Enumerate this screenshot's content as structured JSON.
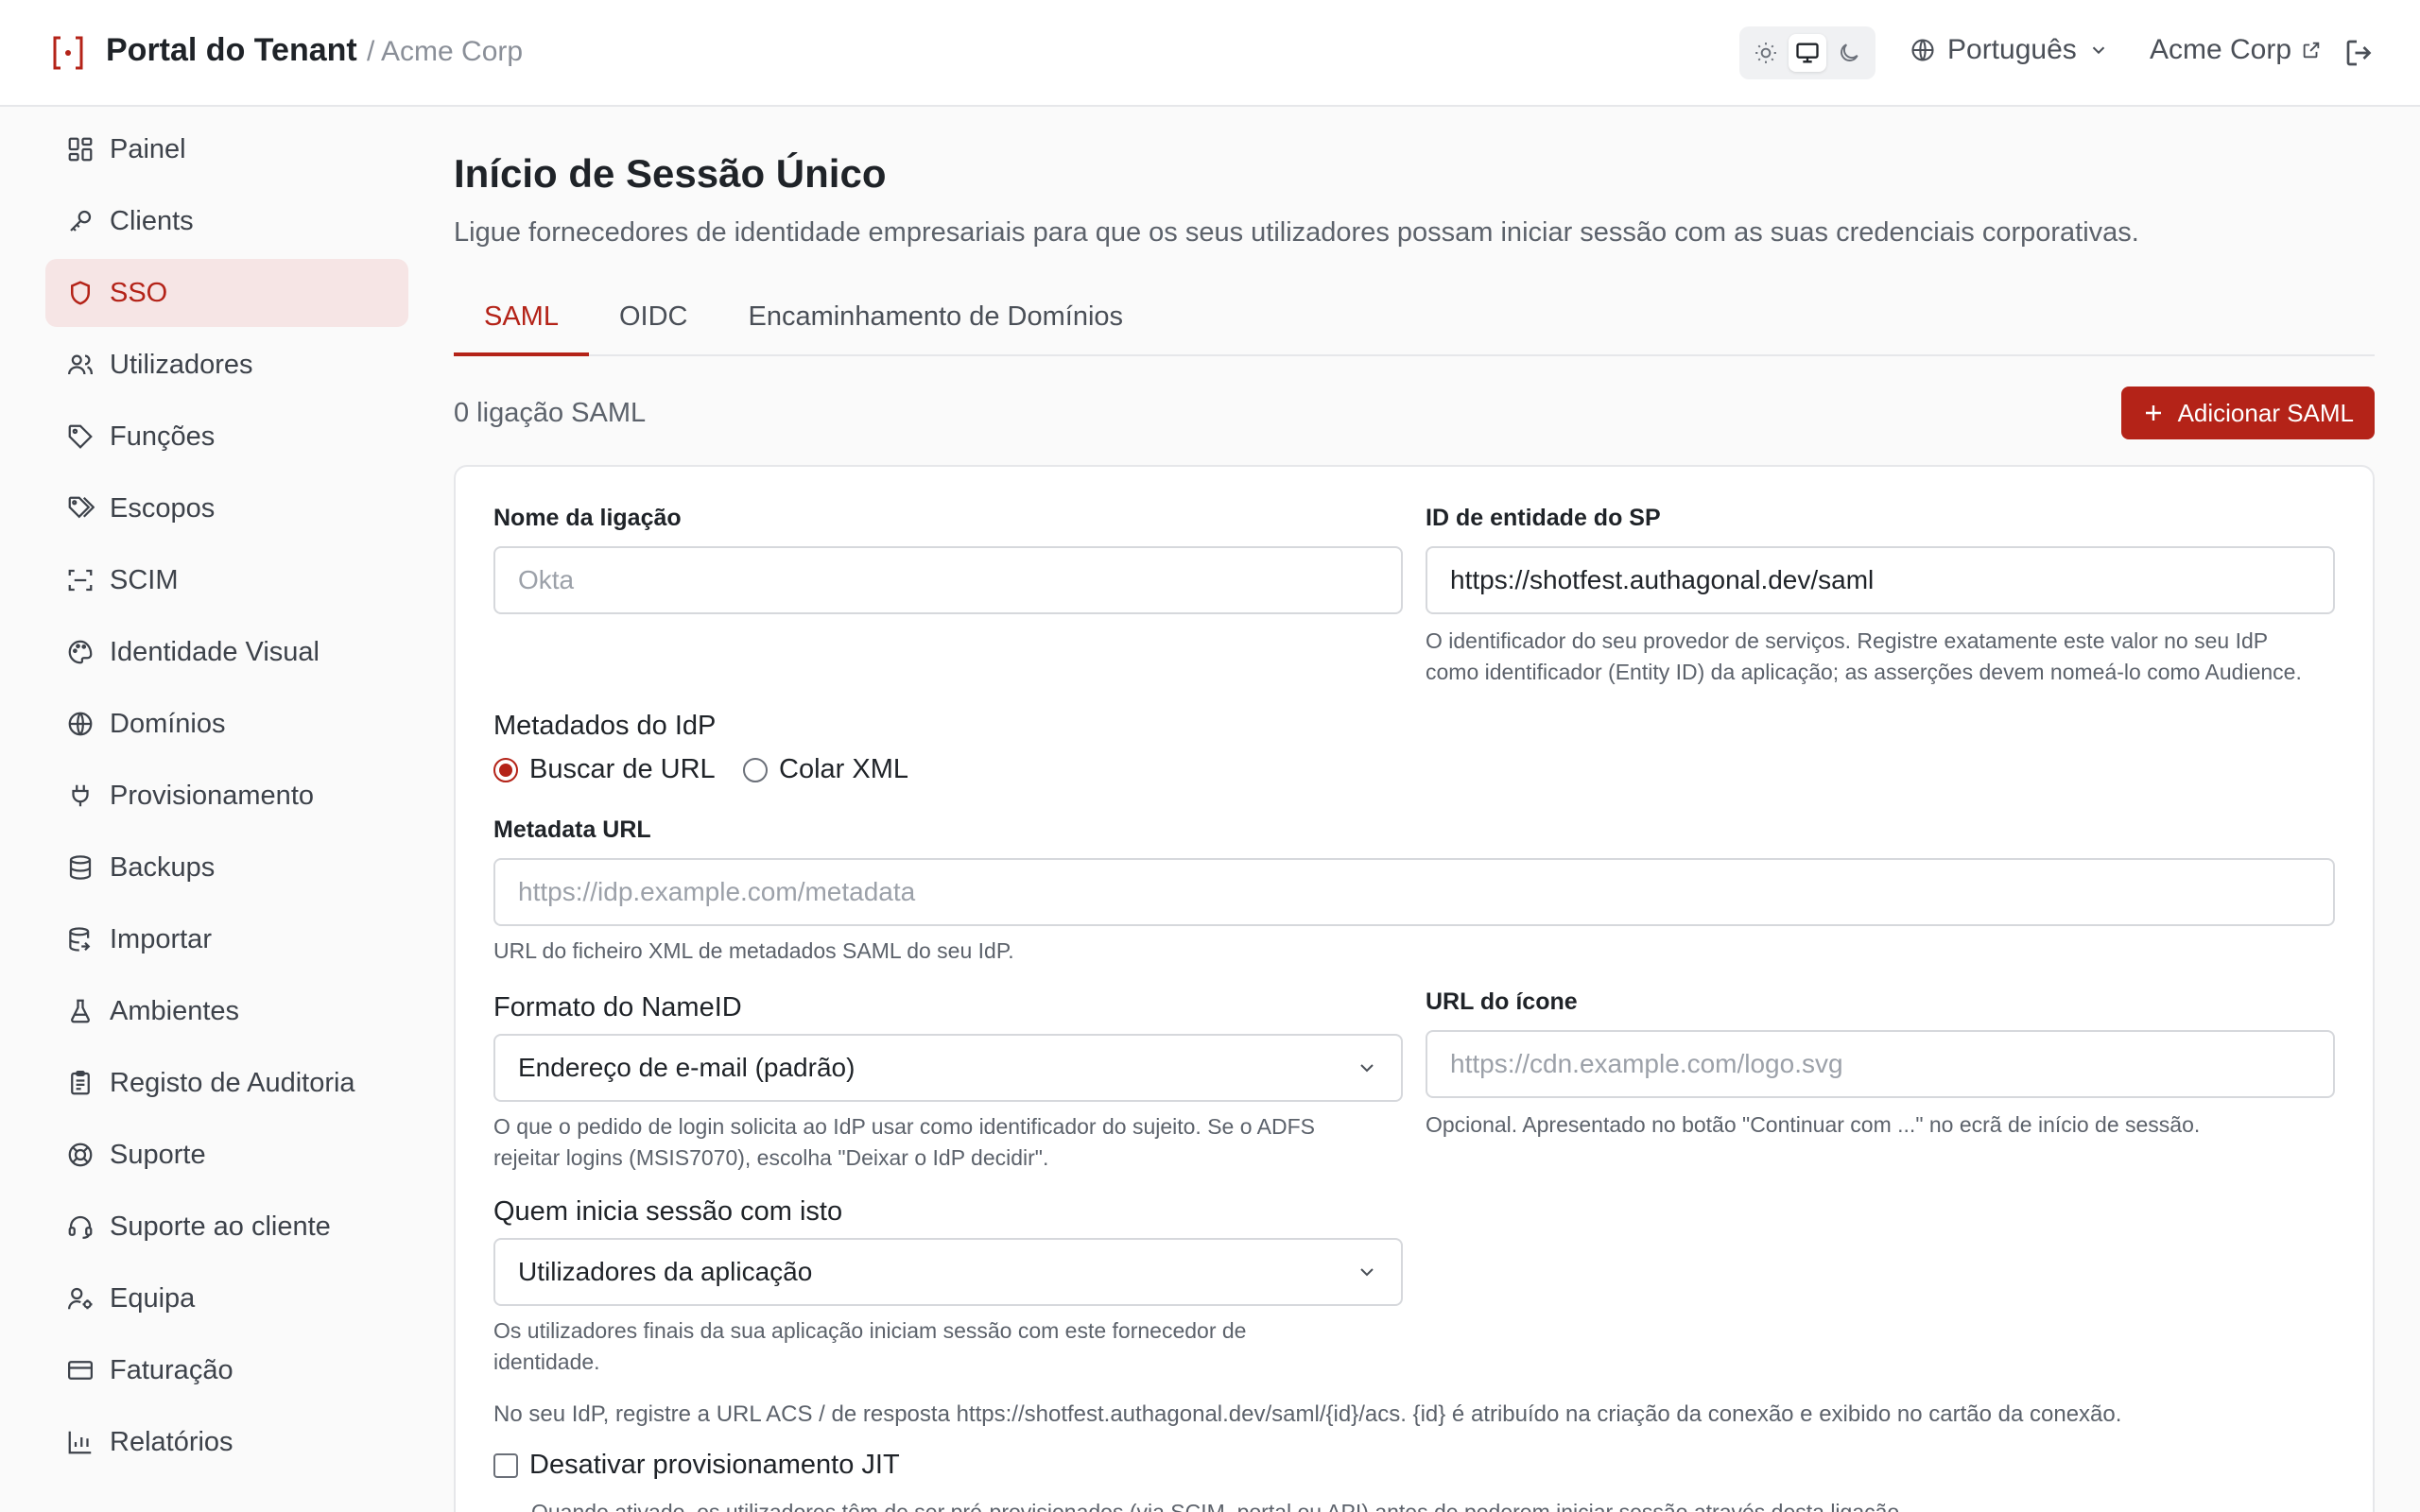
{
  "header": {
    "brand_title": "Portal do Tenant",
    "brand_sub": "/ Acme Corp",
    "language": "Português",
    "tenant_link": "Acme Corp"
  },
  "colors": {
    "accent": "#b42318",
    "active_bg": "#f6e5e5"
  },
  "sidebar": {
    "items": [
      {
        "label": "Painel",
        "icon": "dashboard-icon"
      },
      {
        "label": "Clients",
        "icon": "key-icon"
      },
      {
        "label": "SSO",
        "icon": "shield-icon"
      },
      {
        "label": "Utilizadores",
        "icon": "users-icon"
      },
      {
        "label": "Funções",
        "icon": "tag-icon"
      },
      {
        "label": "Escopos",
        "icon": "tags-icon"
      },
      {
        "label": "SCIM",
        "icon": "scan-icon"
      },
      {
        "label": "Identidade Visual",
        "icon": "palette-icon"
      },
      {
        "label": "Domínios",
        "icon": "globe-icon"
      },
      {
        "label": "Provisionamento",
        "icon": "plug-icon"
      },
      {
        "label": "Backups",
        "icon": "database-icon"
      },
      {
        "label": "Importar",
        "icon": "database-import-icon"
      },
      {
        "label": "Ambientes",
        "icon": "flask-icon"
      },
      {
        "label": "Registo de Auditoria",
        "icon": "clipboard-icon"
      },
      {
        "label": "Suporte",
        "icon": "lifebuoy-icon"
      },
      {
        "label": "Suporte ao cliente",
        "icon": "headset-icon"
      },
      {
        "label": "Equipa",
        "icon": "user-cog-icon"
      },
      {
        "label": "Faturação",
        "icon": "credit-card-icon"
      },
      {
        "label": "Relatórios",
        "icon": "chart-icon"
      }
    ]
  },
  "main": {
    "title": "Início de Sessão Único",
    "description": "Ligue fornecedores de identidade empresariais para que os seus utilizadores possam iniciar sessão com as suas credenciais corporativas.",
    "tabs": [
      {
        "label": "SAML"
      },
      {
        "label": "OIDC"
      },
      {
        "label": "Encaminhamento de Domínios"
      }
    ],
    "count": "0 ligação SAML",
    "add_button": "Adicionar SAML"
  },
  "form": {
    "connection_name_label": "Nome da ligação",
    "connection_name_placeholder": "Okta",
    "sp_entity_label": "ID de entidade do SP",
    "sp_entity_value": "https://shotfest.authagonal.dev/saml",
    "sp_entity_help_1": "O identificador do seu provedor de serviços. Registre exatamente este valor no seu IdP",
    "sp_entity_help_2": "como identificador (Entity ID) da aplicação; as asserções devem nomeá-lo como Audience.",
    "metadata_group": "Metadados do IdP",
    "radio_fetch": "Buscar de URL",
    "radio_paste": "Colar XML",
    "metadata_url_label": "Metadata URL",
    "metadata_url_placeholder": "https://idp.example.com/metadata",
    "metadata_url_help": "URL do ficheiro XML de metadados SAML do seu IdP.",
    "nameid_label": "Formato do NameID",
    "nameid_value": "Endereço de e-mail (padrão)",
    "nameid_help_1": "O que o pedido de login solicita ao IdP usar como identificador do sujeito. Se o ADFS",
    "nameid_help_2": "rejeitar logins (MSIS7070), escolha \"Deixar o IdP decidir\".",
    "icon_url_label": "URL do ícone",
    "icon_url_placeholder": "https://cdn.example.com/logo.svg",
    "icon_url_help": "Opcional. Apresentado no botão \"Continuar com ...\" no ecrã de início de sessão.",
    "who_label": "Quem inicia sessão com isto",
    "who_value": "Utilizadores da aplicação",
    "who_help_1": "Os utilizadores finais da sua aplicação iniciam sessão com este fornecedor de",
    "who_help_2": "identidade.",
    "acs_note": "No seu IdP, registre a URL ACS / de resposta https://shotfest.authagonal.dev/saml/{id}/acs. {id} é atribuído na criação da conexão e exibido no cartão da conexão.",
    "jit_label": "Desativar provisionamento JIT",
    "jit_help": "Quando ativado, os utilizadores têm de ser pré-provisionados (via SCIM, portal ou API) antes de poderem iniciar sessão através desta ligação."
  }
}
